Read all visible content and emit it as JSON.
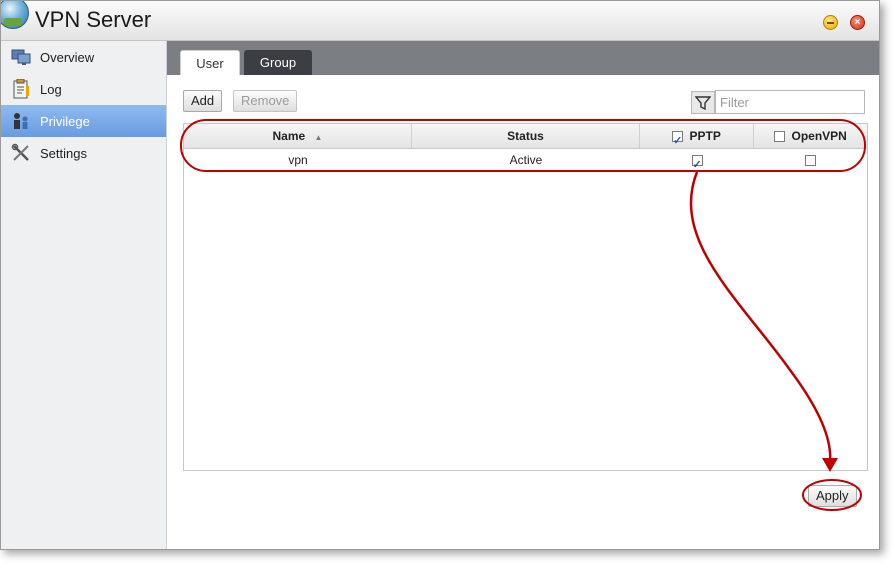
{
  "window": {
    "title": "VPN Server"
  },
  "sidebar": {
    "items": [
      {
        "label": "Overview",
        "icon": "monitors-icon"
      },
      {
        "label": "Log",
        "icon": "clipboard-icon"
      },
      {
        "label": "Privilege",
        "icon": "users-icon",
        "active": true
      },
      {
        "label": "Settings",
        "icon": "tools-icon"
      }
    ]
  },
  "tabs": [
    {
      "label": "User",
      "active": true
    },
    {
      "label": "Group",
      "active": false
    }
  ],
  "toolbar": {
    "add_label": "Add",
    "remove_label": "Remove"
  },
  "filter": {
    "placeholder": "Filter",
    "value": ""
  },
  "table": {
    "columns": [
      {
        "label": "Name",
        "sort": "ascending"
      },
      {
        "label": "Status"
      },
      {
        "label": "PPTP",
        "header_checkbox_checked": true
      },
      {
        "label": "OpenVPN",
        "header_checkbox_checked": false
      }
    ],
    "rows": [
      {
        "name": "vpn",
        "status": "Active",
        "pptp": true,
        "openvpn": false
      }
    ]
  },
  "apply_label": "Apply",
  "colors": {
    "annotation": "#c00000",
    "active_nav": "#7aa7e8",
    "tab_bar": "#7b7f84"
  }
}
